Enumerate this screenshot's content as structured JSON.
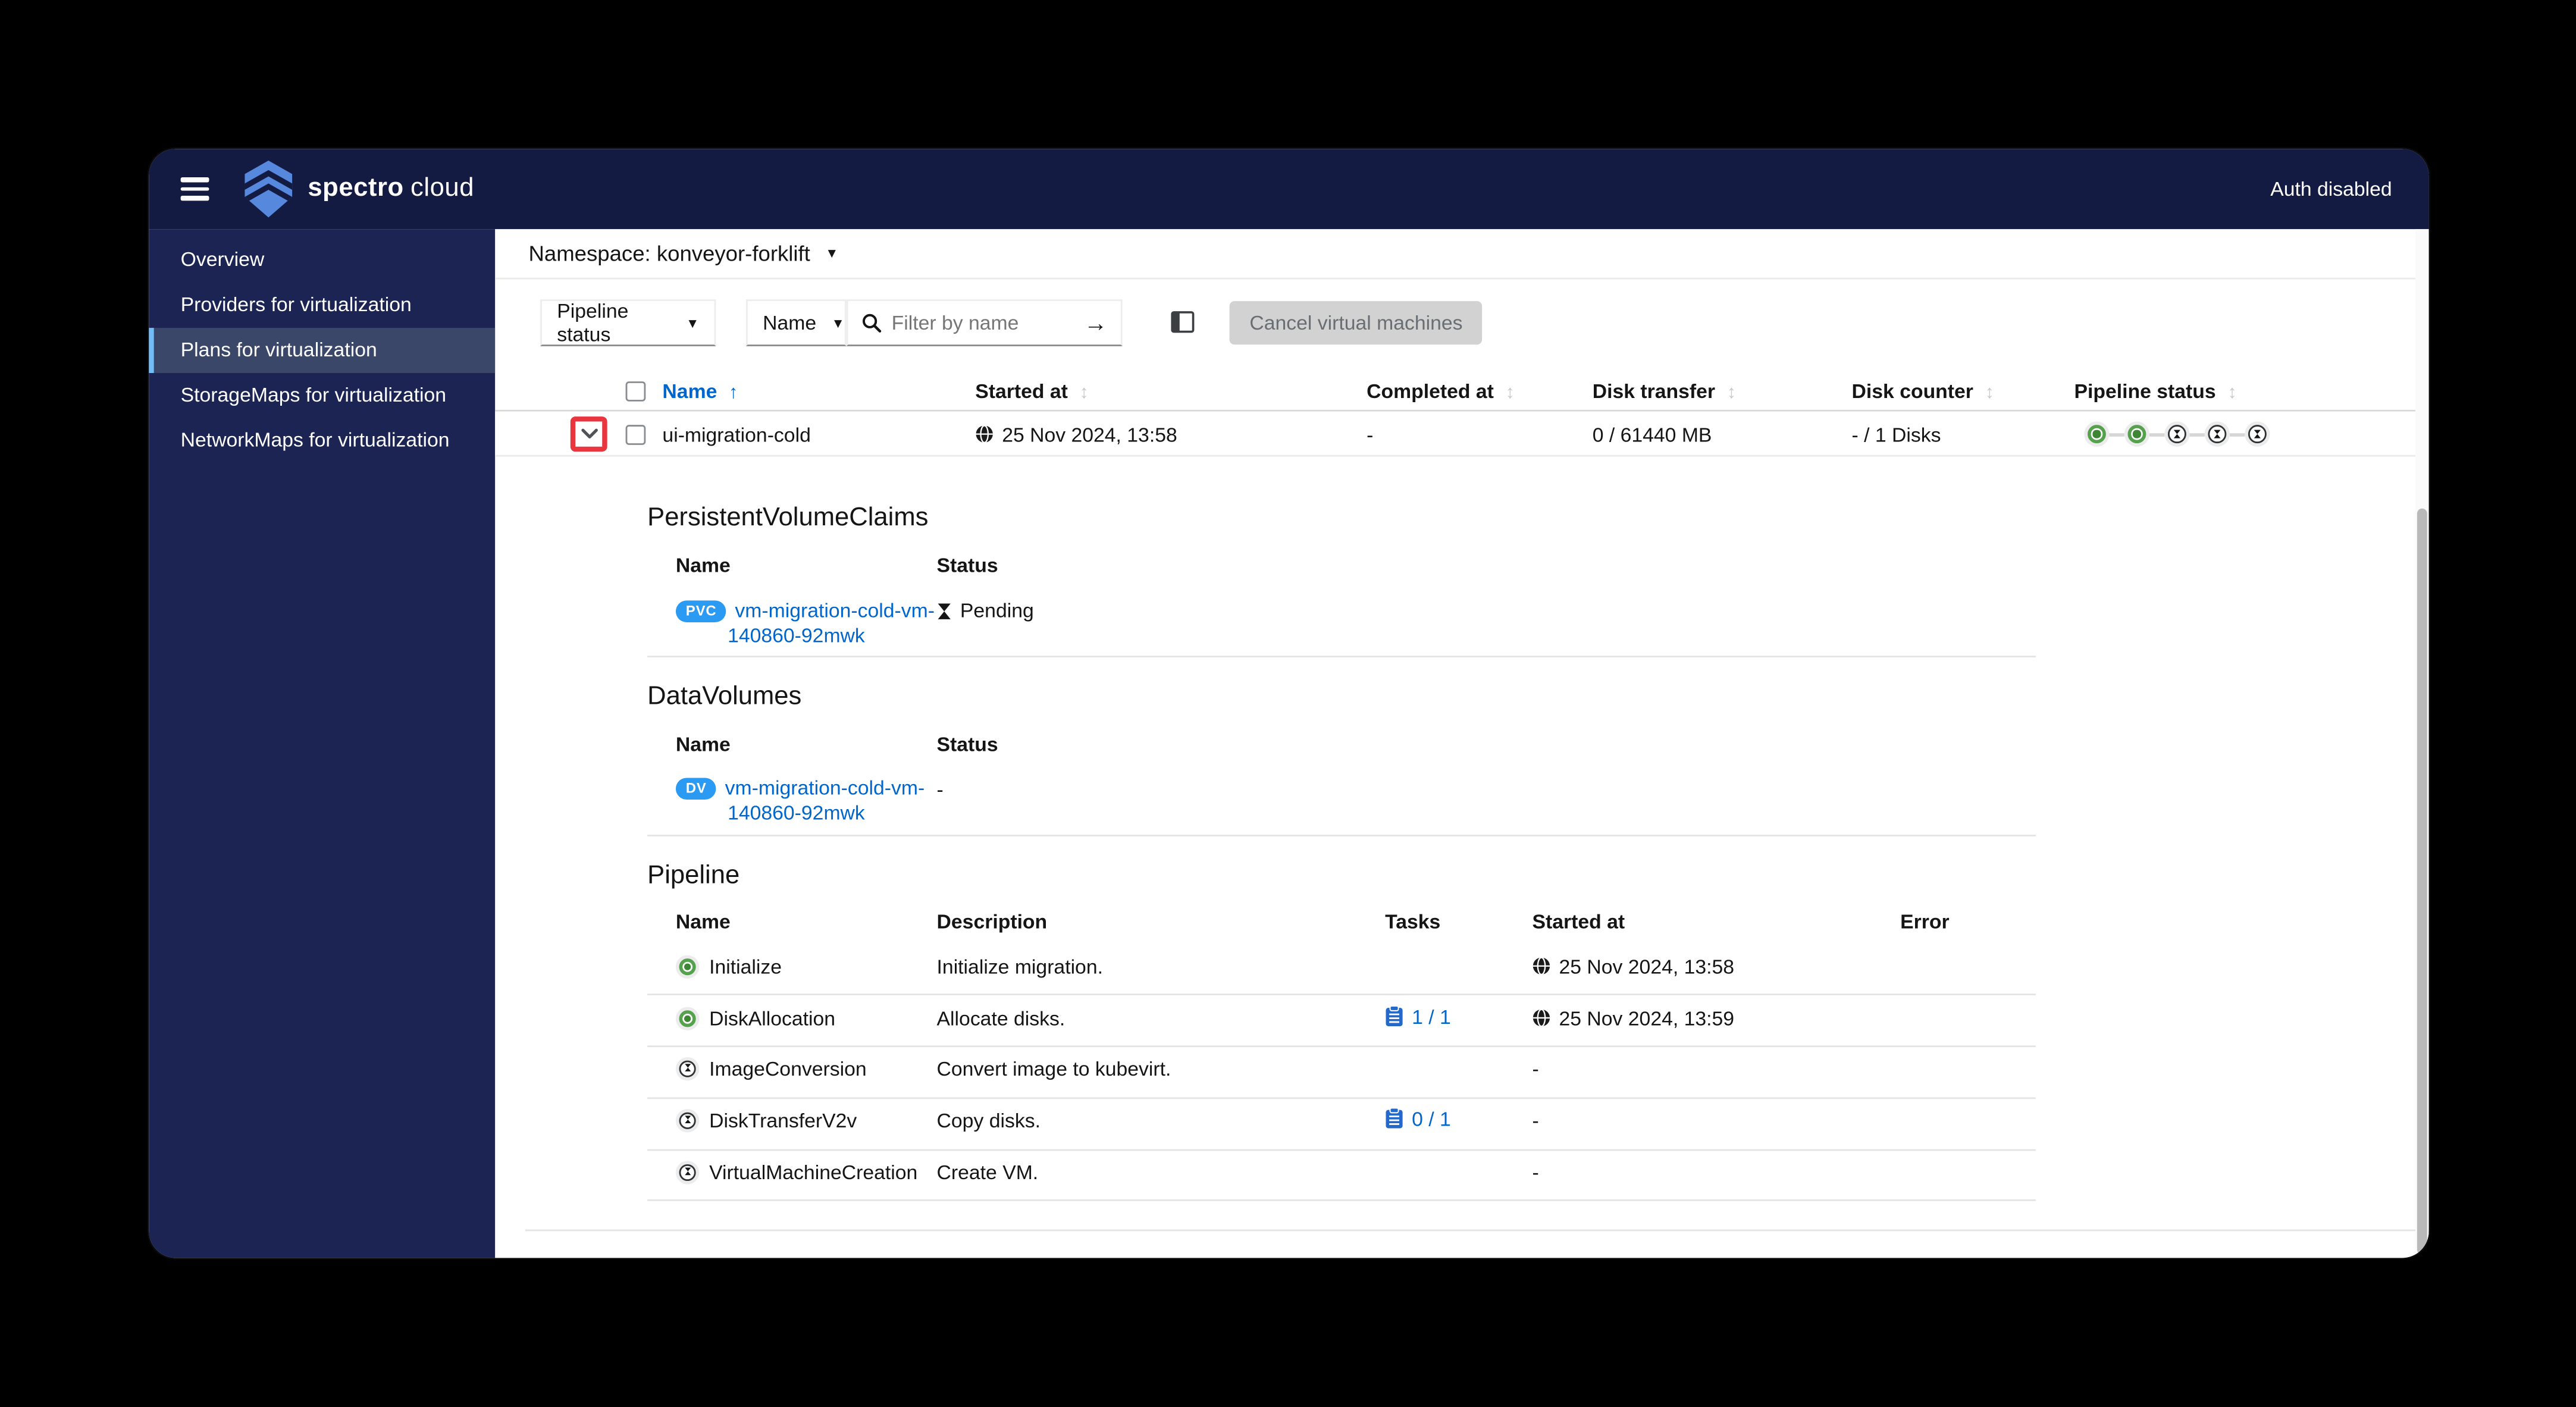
{
  "window": {
    "brand": {
      "primary": "spectro",
      "secondary": "cloud"
    },
    "auth_status": "Auth disabled"
  },
  "sidebar": {
    "items": [
      {
        "label": "Overview",
        "selected": false
      },
      {
        "label": "Providers for virtualization",
        "selected": false
      },
      {
        "label": "Plans for virtualization",
        "selected": true
      },
      {
        "label": "StorageMaps for virtualization",
        "selected": false
      },
      {
        "label": "NetworkMaps for virtualization",
        "selected": false
      }
    ]
  },
  "namespace": {
    "label": "Namespace: konveyor-forklift"
  },
  "toolbar": {
    "category_select": "Pipeline status",
    "field_select": "Name",
    "search_placeholder": "Filter by name",
    "cancel_button": "Cancel virtual machines"
  },
  "plans_table": {
    "headers": {
      "name": "Name",
      "started_at": "Started at",
      "completed_at": "Completed at",
      "disk_transfer": "Disk transfer",
      "disk_counter": "Disk counter",
      "pipeline_status": "Pipeline status"
    },
    "row": {
      "name": "ui-migration-cold",
      "started_at": "25 Nov 2024, 13:58",
      "completed_at": "-",
      "disk_transfer": "0 / 61440 MB",
      "disk_counter": "- / 1 Disks",
      "pipeline_states": [
        "done",
        "done",
        "pending",
        "pending",
        "pending"
      ]
    }
  },
  "pvc_section": {
    "title": "PersistentVolumeClaims",
    "col_name": "Name",
    "col_status": "Status",
    "row": {
      "badge": "PVC",
      "name_line1": "vm-migration-cold-vm-",
      "name_line2": "140860-92mwk",
      "status": "Pending"
    }
  },
  "dv_section": {
    "title": "DataVolumes",
    "col_name": "Name",
    "col_status": "Status",
    "row": {
      "badge": "DV",
      "name_line1": "vm-migration-cold-vm-",
      "name_line2": "140860-92mwk",
      "status": "-"
    }
  },
  "pipeline_section": {
    "title": "Pipeline",
    "col_name": "Name",
    "col_description": "Description",
    "col_tasks": "Tasks",
    "col_started": "Started at",
    "col_error": "Error",
    "rows": [
      {
        "state": "done",
        "name": "Initialize",
        "description": "Initialize migration.",
        "tasks": "",
        "started_at": "25 Nov 2024, 13:58",
        "error": ""
      },
      {
        "state": "done",
        "name": "DiskAllocation",
        "description": "Allocate disks.",
        "tasks": "1 / 1",
        "started_at": "25 Nov 2024, 13:59",
        "error": ""
      },
      {
        "state": "pending",
        "name": "ImageConversion",
        "description": "Convert image to kubevirt.",
        "tasks": "",
        "started_at": "-",
        "error": ""
      },
      {
        "state": "pending",
        "name": "DiskTransferV2v",
        "description": "Copy disks.",
        "tasks": "0 / 1",
        "started_at": "-",
        "error": ""
      },
      {
        "state": "pending",
        "name": "VirtualMachineCreation",
        "description": "Create VM.",
        "tasks": "",
        "started_at": "-",
        "error": ""
      }
    ]
  },
  "colors": {
    "header_bg": "#131b42",
    "sidebar_bg": "#1b2452",
    "sidebar_selected_bg": "#3a4768",
    "sidebar_accent": "#73bcf7",
    "link_blue": "#0066cc",
    "badge_blue": "#2b9af3",
    "success_green": "#55a14e",
    "annotation_red": "#e8353e",
    "disabled_button_bg": "#d2d2d2"
  }
}
